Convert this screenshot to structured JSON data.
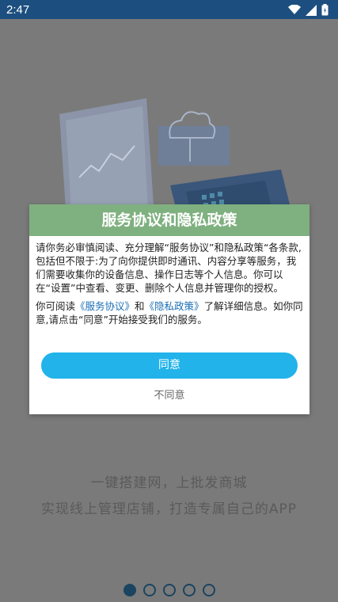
{
  "status_bar": {
    "time": "2:47",
    "icons": [
      "wifi-icon",
      "signal-icon",
      "battery-icon"
    ]
  },
  "dialog": {
    "title": "服务协议和隐私政策",
    "para1": "请你务必审慎阅读、充分理解“服务协议”和隐私政策“各条款,包括但不限于:为了向你提供即时通讯、内容分享等服务，我们需要收集你的设备信息、操作日志等个人信息。你可以在“设置”中查看、变更、删除个人信息并管理你的授权。",
    "para2_a": "你可阅读",
    "link_service": "《服务协议》",
    "para2_b": "和",
    "link_privacy": "《隐私政策》",
    "para2_c": "了解详细信息。如你同意,请点击“同意”开始接受我们的服务。",
    "agree": "同意",
    "disagree": "不同意"
  },
  "onboarding": {
    "tagline1": "一键搭建网，上批发商城",
    "tagline2": "实现线上管理店铺，打造专属自己的APP",
    "page_count": 5,
    "current_page": 1
  },
  "colors": {
    "status_bar": "#1c4f7f",
    "dialog_header": "#7fb07f",
    "agree_button": "#21b3ea",
    "link": "#1a6fb5"
  }
}
